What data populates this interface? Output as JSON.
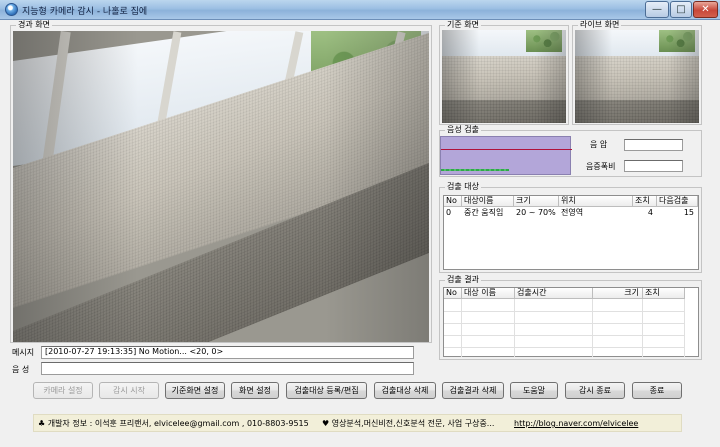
{
  "window": {
    "title": "지능형 카메라 감시 - 나홀로 집에",
    "minimize": "—",
    "maximize": "□",
    "close": "✕"
  },
  "groups": {
    "result_view": "경과 화면",
    "reference_view": "기준 화면",
    "live_view": "라이브 화면",
    "audio_detect": "음성 검출",
    "detect_targets": "검출 대상",
    "detect_results": "검출 결과"
  },
  "audio": {
    "pressure_label": "음 압",
    "pressure_value": "",
    "ratio_label": "음증폭비",
    "ratio_value": ""
  },
  "targets_table": {
    "columns": [
      "No",
      "대상이름",
      "크기",
      "위치",
      "조치",
      "다음검출"
    ],
    "rows": [
      [
        "0",
        "중간 움직임",
        "20 ~ 70%",
        "전영역",
        "4",
        "15"
      ]
    ]
  },
  "results_table": {
    "columns": [
      "No",
      "대상 이름",
      "검출시간",
      "크기",
      "조치"
    ],
    "rows": []
  },
  "message": {
    "label": "메시지",
    "value": "[2010-07-27 19:13:35]  No Motion... <20, 0>"
  },
  "voice": {
    "label": "음  성",
    "value": ""
  },
  "buttons": {
    "camera_settings": "카메라 설정",
    "start_monitor": "감시 시작",
    "set_reference": "기준화면 설정",
    "screen_settings": "화면 설정",
    "register_target": "검출대상 등록/편집",
    "delete_target": "검출대상 삭제",
    "delete_results": "검출결과 삭제",
    "help": "도움말",
    "stop_monitor": "감시 종료",
    "exit": "종료"
  },
  "info": {
    "developer": "♣ 개발자 정보 : 이석훈 프리랜서,   elvicelee@gmail.com , 010-8803-9515",
    "specialty": "♥ 영상분석,머신비전,신호분석 전문, 사업 구상중...",
    "blog": "http://blog.naver.com/elvicelee"
  }
}
